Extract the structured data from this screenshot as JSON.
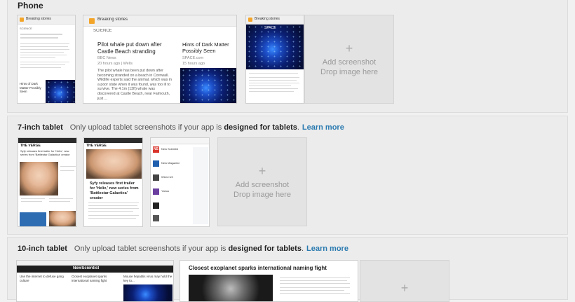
{
  "phone": {
    "title": "Phone",
    "shots": [
      {
        "app_title": "Breaking stories",
        "section": "SCIENCE",
        "tile_title": "Hints of Dark Matter Possibly Seen"
      },
      {
        "app_title": "Breaking stories",
        "section": "SCIENCE",
        "headline": "Pilot whale put down after Castle Beach stranding",
        "source": "BBC News",
        "time": "20 hours ago | Wells",
        "body": "The pilot whale has been put down after becoming stranded on a beach in Cornwall. Wildlife experts said the animal, which was in a poor state when it was found, was too ill to survive. The 4.1m (13ft) whale was discovered at Castle Beach, near Falmouth, just ...",
        "side_title": "Hints of Dark Matter Possibly Seen",
        "side_source": "SPACE.com",
        "side_time": "15 hours ago"
      },
      {
        "app_title": "Breaking stories",
        "space_label": "SPACE"
      }
    ],
    "drop": {
      "plus": "+",
      "line1": "Add screenshot",
      "line2": "Drop image here"
    }
  },
  "tablet7": {
    "title": "7-inch tablet",
    "note_prefix": "Only upload tablet screenshots if your app is",
    "note_bold": "designed for tablets",
    "note_suffix": ".",
    "link": "Learn more",
    "shots": [
      {
        "logo": "THE VERGE",
        "headline": "Syfy releases first trailer for 'Helix,' new series from 'Battlestar Galactica' creator"
      },
      {
        "logo": "THE VERGE",
        "headline": "Syfy releases first trailer for 'Helix,' new series from 'Battlestar Galactica' creator"
      },
      {
        "logo": "NS",
        "items": [
          "New Scientist",
          "New Magazine",
          "Wired UK",
          "Yahoo"
        ]
      }
    ],
    "drop": {
      "plus": "+",
      "line1": "Add screenshot",
      "line2": "Drop image here"
    }
  },
  "tablet10": {
    "title": "10-inch tablet",
    "note_prefix": "Only upload tablet screenshots if your app is",
    "note_bold": "designed for tablets",
    "note_suffix": ".",
    "link": "Learn more",
    "shots": [
      {
        "masthead": "NewScientist",
        "cells": [
          "Use the internet to defuse gang culture",
          "Closest exoplanet sparks international naming fight",
          "Mouse hepatitis virus may hold the key to..."
        ]
      },
      {
        "headline": "Closest exoplanet sparks international naming fight"
      }
    ],
    "drop": {
      "plus": "+"
    }
  },
  "colors": {
    "link": "#2a7ab0",
    "accent_orange": "#f3a52a"
  }
}
